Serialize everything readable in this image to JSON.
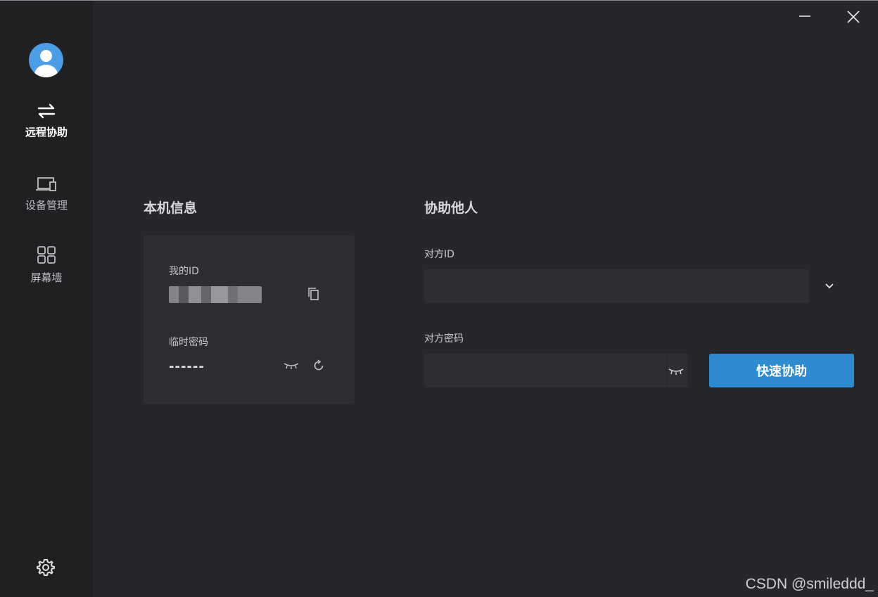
{
  "sidebar": {
    "items": [
      {
        "label": "远程协助",
        "icon": "swap-arrows-icon",
        "active": true
      },
      {
        "label": "设备管理",
        "icon": "devices-icon",
        "active": false
      },
      {
        "label": "屏幕墙",
        "icon": "grid-icon",
        "active": false
      }
    ],
    "settings_icon": "gear-icon"
  },
  "local": {
    "title": "本机信息",
    "my_id_label": "我的ID",
    "temp_pwd_label": "临时密码",
    "temp_pwd_value": "------"
  },
  "remote": {
    "title": "协助他人",
    "peer_id_label": "对方ID",
    "peer_pwd_label": "对方密码",
    "connect_label": "快速协助"
  },
  "watermark": "CSDN @smileddd_",
  "colors": {
    "accent": "#2f8bd0",
    "sidebar_bg": "#1f2022",
    "main_bg": "#26272a"
  }
}
